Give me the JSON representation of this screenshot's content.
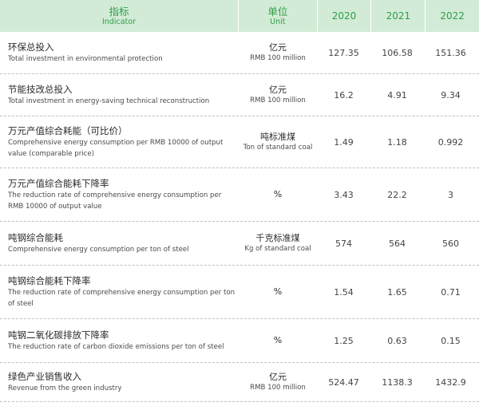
{
  "header": {
    "indicator_zh": "指标",
    "indicator_en": "Indicator",
    "unit_zh": "单位",
    "unit_en": "Unit",
    "years": [
      "2020",
      "2021",
      "2022"
    ]
  },
  "rows": [
    {
      "zh": "环保总投入",
      "en": "Total investment in environmental protection",
      "unit_zh": "亿元",
      "unit_en": "RMB 100 million",
      "values": [
        "127.35",
        "106.58",
        "151.36"
      ]
    },
    {
      "zh": "节能技改总投入",
      "en": "Total investment in energy-saving technical reconstruction",
      "unit_zh": "亿元",
      "unit_en": "RMB 100 million",
      "values": [
        "16.2",
        "4.91",
        "9.34"
      ]
    },
    {
      "zh": "万元产值综合耗能（可比价）",
      "en": "Comprehensive energy consumption per  RMB 10000 of output value (comparable price)",
      "unit_zh": "吨标准煤",
      "unit_en": "Ton of standard coal",
      "values": [
        "1.49",
        "1.18",
        "0.992"
      ]
    },
    {
      "zh": "万元产值综合能耗下降率",
      "en": "The reduction rate of comprehensive energy consumption per RMB 10000 of output value",
      "unit_zh": "%",
      "unit_en": "",
      "values": [
        "3.43",
        "22.2",
        "3"
      ]
    },
    {
      "zh": "吨钢综合能耗",
      "en": "Comprehensive energy consumption per ton of steel",
      "unit_zh": "千克标准煤",
      "unit_en": "Kg of standard coal",
      "values": [
        "574",
        "564",
        "560"
      ]
    },
    {
      "zh": "吨钢综合能耗下降率",
      "en": "The reduction rate of comprehensive energy consumption per ton of steel",
      "unit_zh": "%",
      "unit_en": "",
      "values": [
        "1.54",
        "1.65",
        "0.71"
      ]
    },
    {
      "zh": "吨钢二氧化碳排放下降率",
      "en": "The reduction rate of carbon dioxide emissions per ton of steel",
      "unit_zh": "%",
      "unit_en": "",
      "values": [
        "1.25",
        "0.63",
        "0.15"
      ]
    },
    {
      "zh": "绿色产业销售收入",
      "en": "Revenue from the green industry",
      "unit_zh": "亿元",
      "unit_en": "RMB 100 million",
      "values": [
        "524.47",
        "1138.3",
        "1432.9"
      ]
    }
  ],
  "colors": {
    "header_bg": "#d2ebd6",
    "header_text": "#2e9e4a"
  }
}
